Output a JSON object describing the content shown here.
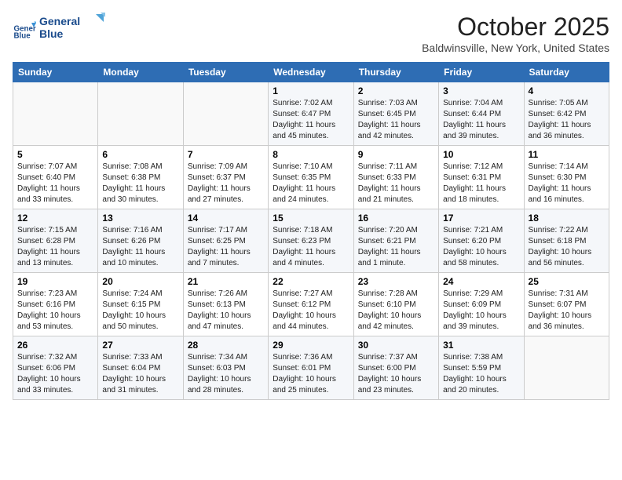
{
  "header": {
    "logo_line1": "General",
    "logo_line2": "Blue",
    "month_title": "October 2025",
    "location": "Baldwinsville, New York, United States"
  },
  "weekdays": [
    "Sunday",
    "Monday",
    "Tuesday",
    "Wednesday",
    "Thursday",
    "Friday",
    "Saturday"
  ],
  "weeks": [
    [
      {
        "day": "",
        "sunrise": "",
        "sunset": "",
        "daylight": ""
      },
      {
        "day": "",
        "sunrise": "",
        "sunset": "",
        "daylight": ""
      },
      {
        "day": "",
        "sunrise": "",
        "sunset": "",
        "daylight": ""
      },
      {
        "day": "1",
        "sunrise": "Sunrise: 7:02 AM",
        "sunset": "Sunset: 6:47 PM",
        "daylight": "Daylight: 11 hours and 45 minutes."
      },
      {
        "day": "2",
        "sunrise": "Sunrise: 7:03 AM",
        "sunset": "Sunset: 6:45 PM",
        "daylight": "Daylight: 11 hours and 42 minutes."
      },
      {
        "day": "3",
        "sunrise": "Sunrise: 7:04 AM",
        "sunset": "Sunset: 6:44 PM",
        "daylight": "Daylight: 11 hours and 39 minutes."
      },
      {
        "day": "4",
        "sunrise": "Sunrise: 7:05 AM",
        "sunset": "Sunset: 6:42 PM",
        "daylight": "Daylight: 11 hours and 36 minutes."
      }
    ],
    [
      {
        "day": "5",
        "sunrise": "Sunrise: 7:07 AM",
        "sunset": "Sunset: 6:40 PM",
        "daylight": "Daylight: 11 hours and 33 minutes."
      },
      {
        "day": "6",
        "sunrise": "Sunrise: 7:08 AM",
        "sunset": "Sunset: 6:38 PM",
        "daylight": "Daylight: 11 hours and 30 minutes."
      },
      {
        "day": "7",
        "sunrise": "Sunrise: 7:09 AM",
        "sunset": "Sunset: 6:37 PM",
        "daylight": "Daylight: 11 hours and 27 minutes."
      },
      {
        "day": "8",
        "sunrise": "Sunrise: 7:10 AM",
        "sunset": "Sunset: 6:35 PM",
        "daylight": "Daylight: 11 hours and 24 minutes."
      },
      {
        "day": "9",
        "sunrise": "Sunrise: 7:11 AM",
        "sunset": "Sunset: 6:33 PM",
        "daylight": "Daylight: 11 hours and 21 minutes."
      },
      {
        "day": "10",
        "sunrise": "Sunrise: 7:12 AM",
        "sunset": "Sunset: 6:31 PM",
        "daylight": "Daylight: 11 hours and 18 minutes."
      },
      {
        "day": "11",
        "sunrise": "Sunrise: 7:14 AM",
        "sunset": "Sunset: 6:30 PM",
        "daylight": "Daylight: 11 hours and 16 minutes."
      }
    ],
    [
      {
        "day": "12",
        "sunrise": "Sunrise: 7:15 AM",
        "sunset": "Sunset: 6:28 PM",
        "daylight": "Daylight: 11 hours and 13 minutes."
      },
      {
        "day": "13",
        "sunrise": "Sunrise: 7:16 AM",
        "sunset": "Sunset: 6:26 PM",
        "daylight": "Daylight: 11 hours and 10 minutes."
      },
      {
        "day": "14",
        "sunrise": "Sunrise: 7:17 AM",
        "sunset": "Sunset: 6:25 PM",
        "daylight": "Daylight: 11 hours and 7 minutes."
      },
      {
        "day": "15",
        "sunrise": "Sunrise: 7:18 AM",
        "sunset": "Sunset: 6:23 PM",
        "daylight": "Daylight: 11 hours and 4 minutes."
      },
      {
        "day": "16",
        "sunrise": "Sunrise: 7:20 AM",
        "sunset": "Sunset: 6:21 PM",
        "daylight": "Daylight: 11 hours and 1 minute."
      },
      {
        "day": "17",
        "sunrise": "Sunrise: 7:21 AM",
        "sunset": "Sunset: 6:20 PM",
        "daylight": "Daylight: 10 hours and 58 minutes."
      },
      {
        "day": "18",
        "sunrise": "Sunrise: 7:22 AM",
        "sunset": "Sunset: 6:18 PM",
        "daylight": "Daylight: 10 hours and 56 minutes."
      }
    ],
    [
      {
        "day": "19",
        "sunrise": "Sunrise: 7:23 AM",
        "sunset": "Sunset: 6:16 PM",
        "daylight": "Daylight: 10 hours and 53 minutes."
      },
      {
        "day": "20",
        "sunrise": "Sunrise: 7:24 AM",
        "sunset": "Sunset: 6:15 PM",
        "daylight": "Daylight: 10 hours and 50 minutes."
      },
      {
        "day": "21",
        "sunrise": "Sunrise: 7:26 AM",
        "sunset": "Sunset: 6:13 PM",
        "daylight": "Daylight: 10 hours and 47 minutes."
      },
      {
        "day": "22",
        "sunrise": "Sunrise: 7:27 AM",
        "sunset": "Sunset: 6:12 PM",
        "daylight": "Daylight: 10 hours and 44 minutes."
      },
      {
        "day": "23",
        "sunrise": "Sunrise: 7:28 AM",
        "sunset": "Sunset: 6:10 PM",
        "daylight": "Daylight: 10 hours and 42 minutes."
      },
      {
        "day": "24",
        "sunrise": "Sunrise: 7:29 AM",
        "sunset": "Sunset: 6:09 PM",
        "daylight": "Daylight: 10 hours and 39 minutes."
      },
      {
        "day": "25",
        "sunrise": "Sunrise: 7:31 AM",
        "sunset": "Sunset: 6:07 PM",
        "daylight": "Daylight: 10 hours and 36 minutes."
      }
    ],
    [
      {
        "day": "26",
        "sunrise": "Sunrise: 7:32 AM",
        "sunset": "Sunset: 6:06 PM",
        "daylight": "Daylight: 10 hours and 33 minutes."
      },
      {
        "day": "27",
        "sunrise": "Sunrise: 7:33 AM",
        "sunset": "Sunset: 6:04 PM",
        "daylight": "Daylight: 10 hours and 31 minutes."
      },
      {
        "day": "28",
        "sunrise": "Sunrise: 7:34 AM",
        "sunset": "Sunset: 6:03 PM",
        "daylight": "Daylight: 10 hours and 28 minutes."
      },
      {
        "day": "29",
        "sunrise": "Sunrise: 7:36 AM",
        "sunset": "Sunset: 6:01 PM",
        "daylight": "Daylight: 10 hours and 25 minutes."
      },
      {
        "day": "30",
        "sunrise": "Sunrise: 7:37 AM",
        "sunset": "Sunset: 6:00 PM",
        "daylight": "Daylight: 10 hours and 23 minutes."
      },
      {
        "day": "31",
        "sunrise": "Sunrise: 7:38 AM",
        "sunset": "Sunset: 5:59 PM",
        "daylight": "Daylight: 10 hours and 20 minutes."
      },
      {
        "day": "",
        "sunrise": "",
        "sunset": "",
        "daylight": ""
      }
    ]
  ]
}
